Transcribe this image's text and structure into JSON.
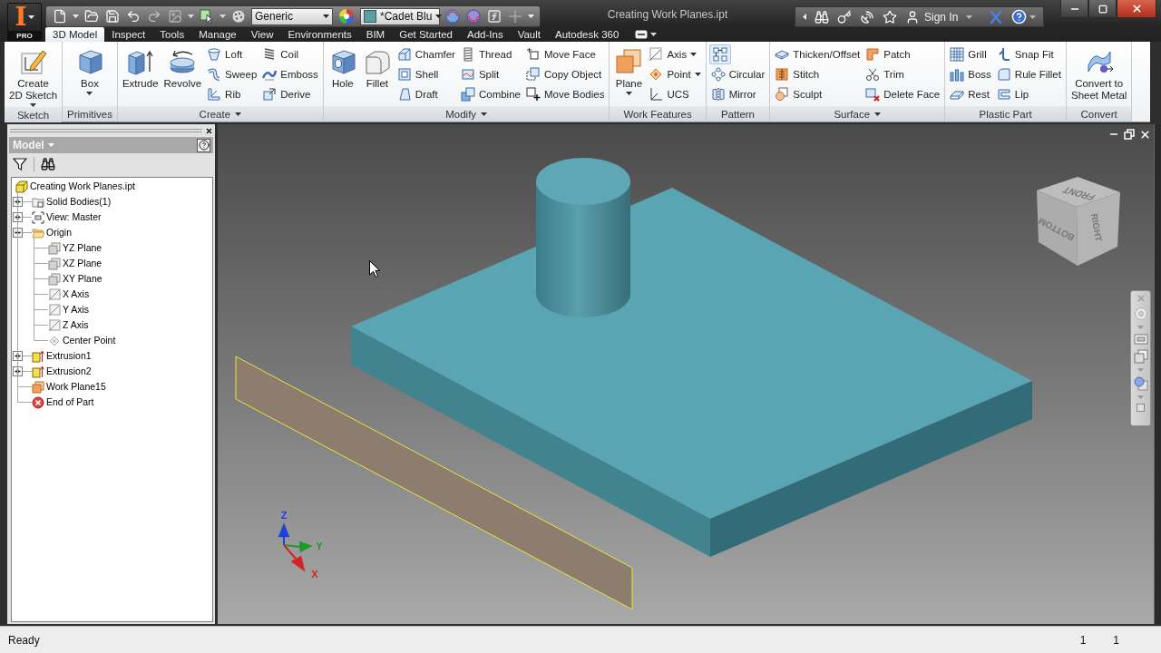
{
  "app_button": {
    "logo": "I",
    "edition": "PRO"
  },
  "quick_access": {
    "material": "Generic",
    "appearance": "*Cadet Blu"
  },
  "title": "Creating Work Planes.ipt",
  "info_center": {
    "sign_in": "Sign In"
  },
  "tabs": [
    {
      "label": "3D Model",
      "selected": true
    },
    {
      "label": "Inspect",
      "selected": false
    },
    {
      "label": "Tools",
      "selected": false
    },
    {
      "label": "Manage",
      "selected": false
    },
    {
      "label": "View",
      "selected": false
    },
    {
      "label": "Environments",
      "selected": false
    },
    {
      "label": "BIM",
      "selected": false
    },
    {
      "label": "Get Started",
      "selected": false
    },
    {
      "label": "Add-Ins",
      "selected": false
    },
    {
      "label": "Vault",
      "selected": false
    },
    {
      "label": "Autodesk 360",
      "selected": false
    }
  ],
  "ribbon": {
    "panels": [
      {
        "title": "Sketch",
        "menu": false,
        "items": [
          {
            "kind": "large",
            "label": "Create\n2D Sketch",
            "dropdown": true
          }
        ]
      },
      {
        "title": "Primitives",
        "menu": false,
        "items": [
          {
            "kind": "large",
            "label": "Box",
            "dropdown": true
          }
        ]
      },
      {
        "title": "Create",
        "menu": true,
        "items": [
          {
            "kind": "large",
            "label": "Extrude",
            "dropdown": false
          },
          {
            "kind": "large",
            "label": "Revolve",
            "dropdown": false
          },
          {
            "kind": "stack",
            "tools": [
              {
                "kind": "small",
                "label": "Loft",
                "dropdown": false
              },
              {
                "kind": "small",
                "label": "Sweep",
                "dropdown": false
              },
              {
                "kind": "small",
                "label": "Rib",
                "dropdown": false
              }
            ]
          },
          {
            "kind": "stack",
            "tools": [
              {
                "kind": "small",
                "label": "Coil",
                "dropdown": false
              },
              {
                "kind": "small",
                "label": "Emboss",
                "dropdown": false
              },
              {
                "kind": "small",
                "label": "Derive",
                "dropdown": false
              }
            ]
          }
        ]
      },
      {
        "title": "Modify",
        "menu": true,
        "items": [
          {
            "kind": "large",
            "label": "Hole",
            "dropdown": false
          },
          {
            "kind": "large",
            "label": "Fillet",
            "dropdown": false
          },
          {
            "kind": "stack",
            "tools": [
              {
                "kind": "small",
                "label": "Chamfer",
                "dropdown": false
              },
              {
                "kind": "small",
                "label": "Shell",
                "dropdown": false
              },
              {
                "kind": "small",
                "label": "Draft",
                "dropdown": false
              }
            ]
          },
          {
            "kind": "stack",
            "tools": [
              {
                "kind": "small",
                "label": "Thread",
                "dropdown": false
              },
              {
                "kind": "small",
                "label": "Split",
                "dropdown": false
              },
              {
                "kind": "small",
                "label": "Combine",
                "dropdown": false
              }
            ]
          },
          {
            "kind": "stack",
            "tools": [
              {
                "kind": "small",
                "label": "Move Face",
                "dropdown": false
              },
              {
                "kind": "small",
                "label": "Copy Object",
                "dropdown": false
              },
              {
                "kind": "small",
                "label": "Move Bodies",
                "dropdown": false
              }
            ]
          }
        ]
      },
      {
        "title": "Work Features",
        "menu": false,
        "items": [
          {
            "kind": "large",
            "label": "Plane",
            "dropdown": true
          },
          {
            "kind": "stack",
            "tools": [
              {
                "kind": "small",
                "label": "Axis",
                "dropdown": true
              },
              {
                "kind": "small",
                "label": "Point",
                "dropdown": true
              },
              {
                "kind": "small",
                "label": "UCS",
                "dropdown": false
              }
            ]
          }
        ]
      },
      {
        "title": "Pattern",
        "menu": false,
        "items": [
          {
            "kind": "stack",
            "tools": [
              {
                "kind": "icon",
                "dropdown": false
              },
              {
                "kind": "small",
                "label": "Circular",
                "dropdown": false
              },
              {
                "kind": "small",
                "label": "Mirror",
                "dropdown": false
              }
            ]
          }
        ]
      },
      {
        "title": "Surface",
        "menu": true,
        "items": [
          {
            "kind": "stack",
            "tools": [
              {
                "kind": "small",
                "label": "Thicken/Offset",
                "dropdown": false
              },
              {
                "kind": "small",
                "label": "Stitch",
                "dropdown": false
              },
              {
                "kind": "small",
                "label": "Sculpt",
                "dropdown": false
              }
            ]
          },
          {
            "kind": "stack",
            "tools": [
              {
                "kind": "small",
                "label": "Patch",
                "dropdown": false
              },
              {
                "kind": "small",
                "label": "Trim",
                "dropdown": false
              },
              {
                "kind": "small",
                "label": "Delete Face",
                "dropdown": false
              }
            ]
          }
        ]
      },
      {
        "title": "Plastic Part",
        "menu": false,
        "items": [
          {
            "kind": "stack",
            "tools": [
              {
                "kind": "small",
                "label": "Grill",
                "dropdown": false
              },
              {
                "kind": "small",
                "label": "Boss",
                "dropdown": false
              },
              {
                "kind": "small",
                "label": "Rest",
                "dropdown": false
              }
            ]
          },
          {
            "kind": "stack",
            "tools": [
              {
                "kind": "small",
                "label": "Snap Fit",
                "dropdown": false
              },
              {
                "kind": "small",
                "label": "Rule Fillet",
                "dropdown": false
              },
              {
                "kind": "small",
                "label": "Lip",
                "dropdown": false
              }
            ]
          }
        ]
      },
      {
        "title": "Convert",
        "menu": false,
        "items": [
          {
            "kind": "large",
            "label": "Convert to\nSheet Metal",
            "dropdown": false
          }
        ]
      }
    ]
  },
  "browser": {
    "title": "Model",
    "tree": {
      "label": "Creating Work Planes.ipt",
      "kind": "part",
      "children": [
        {
          "label": "Solid Bodies(1)",
          "kind": "bodies",
          "expanded": false
        },
        {
          "label": "View: Master",
          "kind": "view",
          "expanded": false
        },
        {
          "label": "Origin",
          "kind": "folder",
          "expanded": true,
          "children": [
            {
              "label": "YZ Plane",
              "kind": "plane"
            },
            {
              "label": "XZ Plane",
              "kind": "plane"
            },
            {
              "label": "XY Plane",
              "kind": "plane"
            },
            {
              "label": "X Axis",
              "kind": "axis"
            },
            {
              "label": "Y Axis",
              "kind": "axis"
            },
            {
              "label": "Z Axis",
              "kind": "axis"
            },
            {
              "label": "Center Point",
              "kind": "point"
            }
          ]
        },
        {
          "label": "Extrusion1",
          "kind": "extrusion",
          "expanded": false
        },
        {
          "label": "Extrusion2",
          "kind": "extrusion",
          "expanded": false
        },
        {
          "label": "Work Plane15",
          "kind": "work-plane"
        },
        {
          "label": "End of Part",
          "kind": "end"
        }
      ]
    }
  },
  "viewport": {
    "view_cube": {
      "faces": [
        "FRONT",
        "RIGHT",
        "BOTTOM"
      ]
    },
    "axes": [
      {
        "label": "Z",
        "color": "#2040d8"
      },
      {
        "label": "Y",
        "color": "#1e9a2c"
      },
      {
        "label": "X",
        "color": "#d42222"
      }
    ]
  },
  "status_bar": {
    "message": "Ready",
    "counters": [
      "1",
      "1"
    ]
  }
}
